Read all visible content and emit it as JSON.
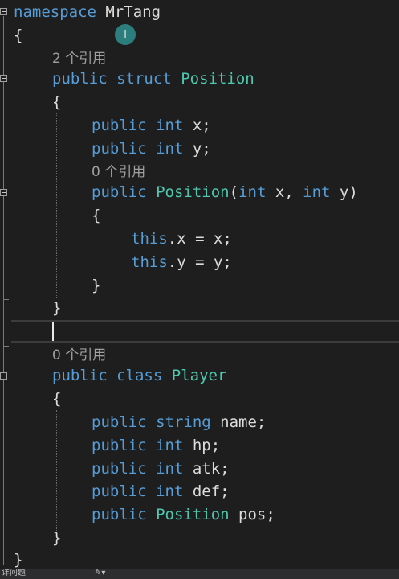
{
  "namespace": {
    "keyword": "namespace",
    "name": "MrTang"
  },
  "braces": {
    "open": "{",
    "close": "}",
    "close_semi": "};"
  },
  "struct_position": {
    "refs": "2 个引用",
    "kw_public": "public",
    "kw_struct": "struct",
    "name": "Position",
    "fields": [
      {
        "mod": "public",
        "type": "int",
        "rest": " x;"
      },
      {
        "mod": "public",
        "type": "int",
        "rest": " y;"
      }
    ],
    "ctor": {
      "refs": "0 个引用",
      "mod": "public",
      "name": "Position",
      "open_paren": "(",
      "p1_type": "int",
      "p1_rest": " x, ",
      "p2_type": "int",
      "p2_rest": " y)",
      "body": [
        {
          "this": "this",
          "rest": ".x = x;"
        },
        {
          "this": "this",
          "rest": ".y = y;"
        }
      ]
    }
  },
  "class_player": {
    "refs": "0 个引用",
    "kw_public": "public",
    "kw_class": "class",
    "name": "Player",
    "fields": [
      {
        "mod": "public",
        "type": "string",
        "rest": " name;"
      },
      {
        "mod": "public",
        "type": "int",
        "rest": " hp;"
      },
      {
        "mod": "public",
        "type": "int",
        "rest": " atk;"
      },
      {
        "mod": "public",
        "type": "int",
        "rest": " def;"
      },
      {
        "mod": "public",
        "type": "Position",
        "rest": " pos;"
      }
    ]
  },
  "cursor_icon": "text-cursor-icon",
  "statusbar": {
    "text": "详问题",
    "icon": "brush-dropdown-icon"
  },
  "colors": {
    "keyword": "#569cd6",
    "type": "#4ec9b0",
    "text": "#dcdcdc",
    "lens": "#a0a0a0",
    "background": "#1e1e1e"
  }
}
